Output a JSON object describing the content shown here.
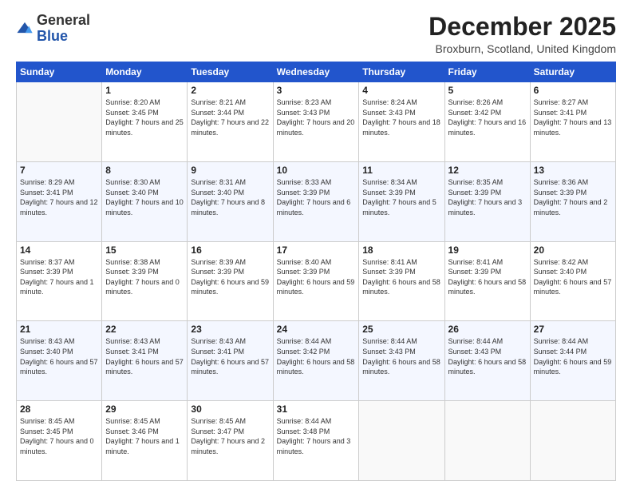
{
  "header": {
    "logo_general": "General",
    "logo_blue": "Blue",
    "month_title": "December 2025",
    "location": "Broxburn, Scotland, United Kingdom"
  },
  "days_of_week": [
    "Sunday",
    "Monday",
    "Tuesday",
    "Wednesday",
    "Thursday",
    "Friday",
    "Saturday"
  ],
  "weeks": [
    [
      {
        "day": "",
        "sunrise": "",
        "sunset": "",
        "daylight": ""
      },
      {
        "day": "1",
        "sunrise": "Sunrise: 8:20 AM",
        "sunset": "Sunset: 3:45 PM",
        "daylight": "Daylight: 7 hours and 25 minutes."
      },
      {
        "day": "2",
        "sunrise": "Sunrise: 8:21 AM",
        "sunset": "Sunset: 3:44 PM",
        "daylight": "Daylight: 7 hours and 22 minutes."
      },
      {
        "day": "3",
        "sunrise": "Sunrise: 8:23 AM",
        "sunset": "Sunset: 3:43 PM",
        "daylight": "Daylight: 7 hours and 20 minutes."
      },
      {
        "day": "4",
        "sunrise": "Sunrise: 8:24 AM",
        "sunset": "Sunset: 3:43 PM",
        "daylight": "Daylight: 7 hours and 18 minutes."
      },
      {
        "day": "5",
        "sunrise": "Sunrise: 8:26 AM",
        "sunset": "Sunset: 3:42 PM",
        "daylight": "Daylight: 7 hours and 16 minutes."
      },
      {
        "day": "6",
        "sunrise": "Sunrise: 8:27 AM",
        "sunset": "Sunset: 3:41 PM",
        "daylight": "Daylight: 7 hours and 13 minutes."
      }
    ],
    [
      {
        "day": "7",
        "sunrise": "Sunrise: 8:29 AM",
        "sunset": "Sunset: 3:41 PM",
        "daylight": "Daylight: 7 hours and 12 minutes."
      },
      {
        "day": "8",
        "sunrise": "Sunrise: 8:30 AM",
        "sunset": "Sunset: 3:40 PM",
        "daylight": "Daylight: 7 hours and 10 minutes."
      },
      {
        "day": "9",
        "sunrise": "Sunrise: 8:31 AM",
        "sunset": "Sunset: 3:40 PM",
        "daylight": "Daylight: 7 hours and 8 minutes."
      },
      {
        "day": "10",
        "sunrise": "Sunrise: 8:33 AM",
        "sunset": "Sunset: 3:39 PM",
        "daylight": "Daylight: 7 hours and 6 minutes."
      },
      {
        "day": "11",
        "sunrise": "Sunrise: 8:34 AM",
        "sunset": "Sunset: 3:39 PM",
        "daylight": "Daylight: 7 hours and 5 minutes."
      },
      {
        "day": "12",
        "sunrise": "Sunrise: 8:35 AM",
        "sunset": "Sunset: 3:39 PM",
        "daylight": "Daylight: 7 hours and 3 minutes."
      },
      {
        "day": "13",
        "sunrise": "Sunrise: 8:36 AM",
        "sunset": "Sunset: 3:39 PM",
        "daylight": "Daylight: 7 hours and 2 minutes."
      }
    ],
    [
      {
        "day": "14",
        "sunrise": "Sunrise: 8:37 AM",
        "sunset": "Sunset: 3:39 PM",
        "daylight": "Daylight: 7 hours and 1 minute."
      },
      {
        "day": "15",
        "sunrise": "Sunrise: 8:38 AM",
        "sunset": "Sunset: 3:39 PM",
        "daylight": "Daylight: 7 hours and 0 minutes."
      },
      {
        "day": "16",
        "sunrise": "Sunrise: 8:39 AM",
        "sunset": "Sunset: 3:39 PM",
        "daylight": "Daylight: 6 hours and 59 minutes."
      },
      {
        "day": "17",
        "sunrise": "Sunrise: 8:40 AM",
        "sunset": "Sunset: 3:39 PM",
        "daylight": "Daylight: 6 hours and 59 minutes."
      },
      {
        "day": "18",
        "sunrise": "Sunrise: 8:41 AM",
        "sunset": "Sunset: 3:39 PM",
        "daylight": "Daylight: 6 hours and 58 minutes."
      },
      {
        "day": "19",
        "sunrise": "Sunrise: 8:41 AM",
        "sunset": "Sunset: 3:39 PM",
        "daylight": "Daylight: 6 hours and 58 minutes."
      },
      {
        "day": "20",
        "sunrise": "Sunrise: 8:42 AM",
        "sunset": "Sunset: 3:40 PM",
        "daylight": "Daylight: 6 hours and 57 minutes."
      }
    ],
    [
      {
        "day": "21",
        "sunrise": "Sunrise: 8:43 AM",
        "sunset": "Sunset: 3:40 PM",
        "daylight": "Daylight: 6 hours and 57 minutes."
      },
      {
        "day": "22",
        "sunrise": "Sunrise: 8:43 AM",
        "sunset": "Sunset: 3:41 PM",
        "daylight": "Daylight: 6 hours and 57 minutes."
      },
      {
        "day": "23",
        "sunrise": "Sunrise: 8:43 AM",
        "sunset": "Sunset: 3:41 PM",
        "daylight": "Daylight: 6 hours and 57 minutes."
      },
      {
        "day": "24",
        "sunrise": "Sunrise: 8:44 AM",
        "sunset": "Sunset: 3:42 PM",
        "daylight": "Daylight: 6 hours and 58 minutes."
      },
      {
        "day": "25",
        "sunrise": "Sunrise: 8:44 AM",
        "sunset": "Sunset: 3:43 PM",
        "daylight": "Daylight: 6 hours and 58 minutes."
      },
      {
        "day": "26",
        "sunrise": "Sunrise: 8:44 AM",
        "sunset": "Sunset: 3:43 PM",
        "daylight": "Daylight: 6 hours and 58 minutes."
      },
      {
        "day": "27",
        "sunrise": "Sunrise: 8:44 AM",
        "sunset": "Sunset: 3:44 PM",
        "daylight": "Daylight: 6 hours and 59 minutes."
      }
    ],
    [
      {
        "day": "28",
        "sunrise": "Sunrise: 8:45 AM",
        "sunset": "Sunset: 3:45 PM",
        "daylight": "Daylight: 7 hours and 0 minutes."
      },
      {
        "day": "29",
        "sunrise": "Sunrise: 8:45 AM",
        "sunset": "Sunset: 3:46 PM",
        "daylight": "Daylight: 7 hours and 1 minute."
      },
      {
        "day": "30",
        "sunrise": "Sunrise: 8:45 AM",
        "sunset": "Sunset: 3:47 PM",
        "daylight": "Daylight: 7 hours and 2 minutes."
      },
      {
        "day": "31",
        "sunrise": "Sunrise: 8:44 AM",
        "sunset": "Sunset: 3:48 PM",
        "daylight": "Daylight: 7 hours and 3 minutes."
      },
      {
        "day": "",
        "sunrise": "",
        "sunset": "",
        "daylight": ""
      },
      {
        "day": "",
        "sunrise": "",
        "sunset": "",
        "daylight": ""
      },
      {
        "day": "",
        "sunrise": "",
        "sunset": "",
        "daylight": ""
      }
    ]
  ]
}
